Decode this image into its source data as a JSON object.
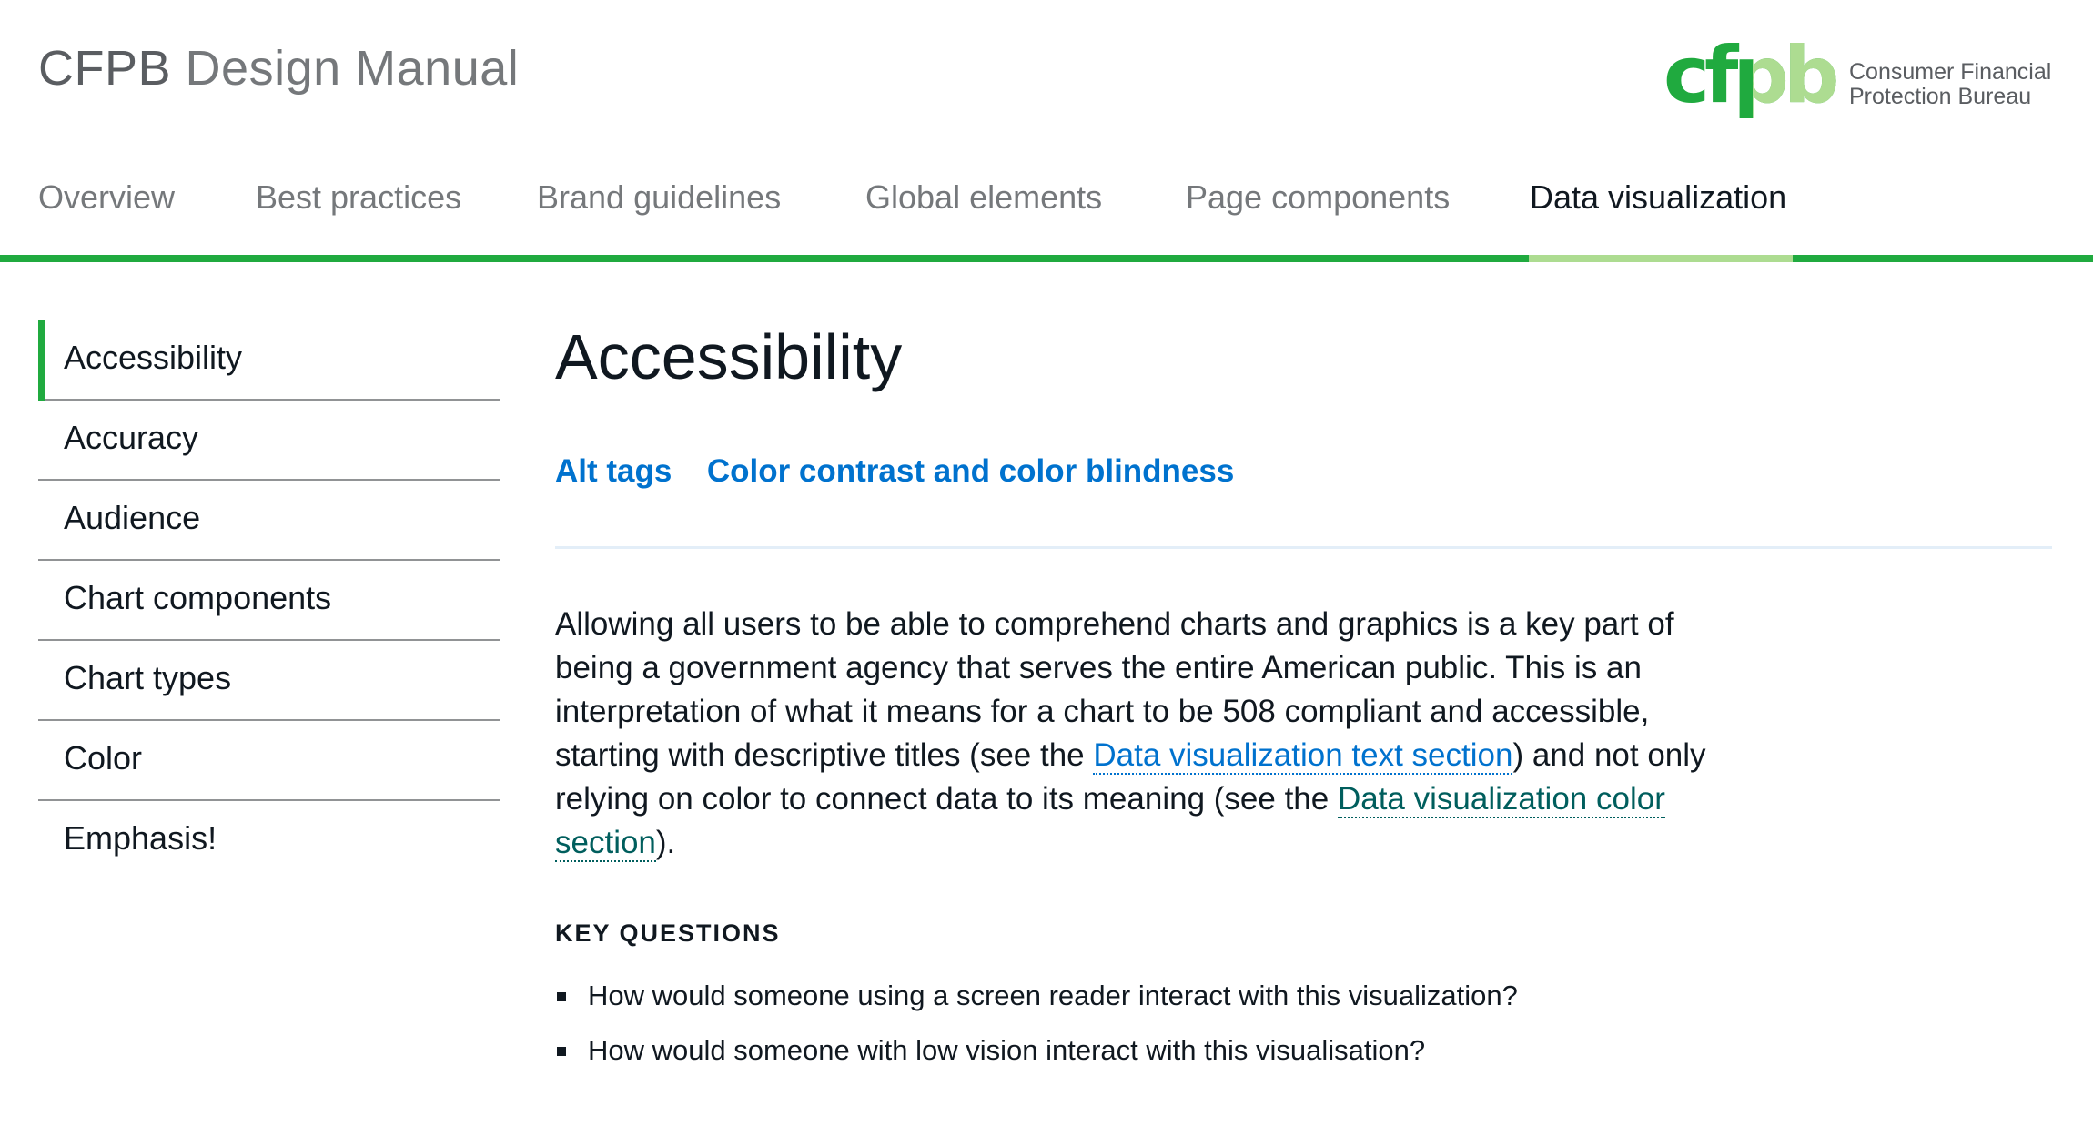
{
  "header": {
    "title_strong": "CFPB",
    "title_light": "Design Manual",
    "logo": {
      "mark": "cfpb",
      "line1": "Consumer Financial",
      "line2": "Protection Bureau"
    }
  },
  "topnav": {
    "items": [
      {
        "label": "Overview"
      },
      {
        "label": "Best practices"
      },
      {
        "label": "Brand guidelines"
      },
      {
        "label": "Global elements"
      },
      {
        "label": "Page components"
      },
      {
        "label": "Data visualization",
        "active": true
      }
    ]
  },
  "sidebar": {
    "items": [
      {
        "label": "Accessibility",
        "active": true
      },
      {
        "label": "Accuracy"
      },
      {
        "label": "Audience"
      },
      {
        "label": "Chart components"
      },
      {
        "label": "Chart types"
      },
      {
        "label": "Color"
      },
      {
        "label": "Emphasis!"
      }
    ]
  },
  "main": {
    "title": "Accessibility",
    "jumplinks": [
      "Alt tags",
      "Color contrast and color blindness"
    ],
    "intro": {
      "part1": "Allowing all users to be able to comprehend charts and graphics is a key part of being a government agency that serves the entire American public. This is an interpretation of what it means for a chart to be 508 compliant and accessible, starting with descriptive titles (see the ",
      "link1": "Data visualization text section",
      "part2": ") and not only relying on color to connect data to its meaning (see the ",
      "link2": "Data visualization color section",
      "part3": ")."
    },
    "key_questions": {
      "heading": "KEY QUESTIONS",
      "items": [
        "How would someone using a screen reader interact with this visualization?",
        "How would someone with low vision interact with this visualisation?"
      ]
    }
  },
  "colors": {
    "brand_green": "#20aa3f",
    "light_green": "#addc91",
    "link_blue": "#0072ce",
    "visited_teal": "#005e5d",
    "text_dark": "#101820",
    "text_gray": "#75787b"
  }
}
